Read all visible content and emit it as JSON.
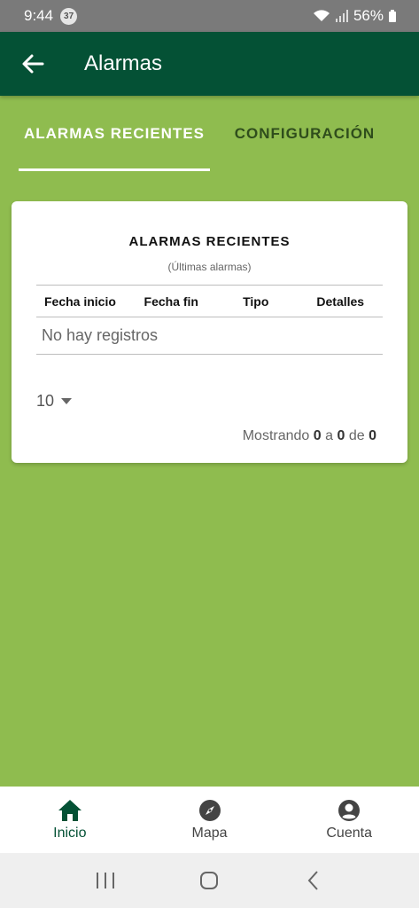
{
  "status_bar": {
    "time": "9:44",
    "notification_count": "37",
    "battery": "56%"
  },
  "app_bar": {
    "title": "Alarmas",
    "back_icon": "arrow-left-icon"
  },
  "tabs": [
    {
      "label": "ALARMAS RECIENTES",
      "active": true
    },
    {
      "label": "CONFIGURACIÓN",
      "active": false
    }
  ],
  "card": {
    "title": "ALARMAS RECIENTES",
    "subtitle": "(Últimas alarmas)",
    "columns": [
      "Fecha inicio",
      "Fecha fin",
      "Tipo",
      "Detalles"
    ],
    "empty_message": "No hay registros",
    "page_size": "10",
    "pagination": {
      "prefix": "Mostrando",
      "from": "0",
      "a": "a",
      "to": "0",
      "de": "de",
      "total": "0"
    }
  },
  "bottom_nav": [
    {
      "label": "Inicio",
      "icon": "home-icon",
      "active": true
    },
    {
      "label": "Mapa",
      "icon": "compass-icon",
      "active": false
    },
    {
      "label": "Cuenta",
      "icon": "account-icon",
      "active": false
    }
  ],
  "colors": {
    "app_bar": "#045135",
    "background": "#8fbc4f",
    "active_nav": "#045135"
  }
}
